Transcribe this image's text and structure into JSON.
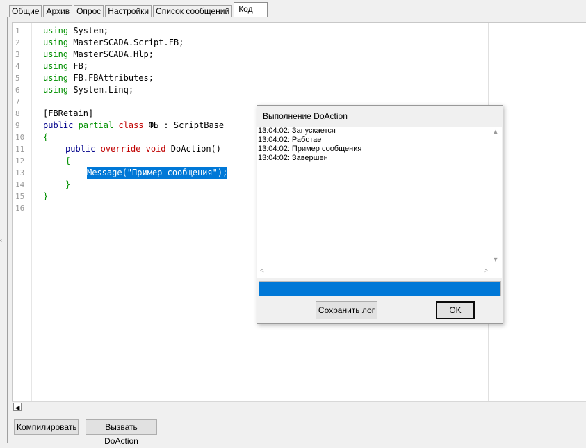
{
  "tabs": [
    {
      "label": "Общие"
    },
    {
      "label": "Архив"
    },
    {
      "label": "Опрос"
    },
    {
      "label": "Настройки"
    },
    {
      "label": "Список сообщений"
    },
    {
      "label": "Код"
    }
  ],
  "active_tab": "Код",
  "code_lines": [
    {
      "n": "1"
    },
    {
      "n": "2"
    },
    {
      "n": "3"
    },
    {
      "n": "4"
    },
    {
      "n": "5"
    },
    {
      "n": "6"
    },
    {
      "n": "7"
    },
    {
      "n": "8"
    },
    {
      "n": "9"
    },
    {
      "n": "10"
    },
    {
      "n": "11"
    },
    {
      "n": "12"
    },
    {
      "n": "13"
    },
    {
      "n": "14"
    },
    {
      "n": "15"
    },
    {
      "n": "16"
    }
  ],
  "code": {
    "l1": [
      "using",
      " System;"
    ],
    "l2": [
      "using",
      " MasterSCADA.Script.FB;"
    ],
    "l3": [
      "using",
      " MasterSCADA.Hlp;"
    ],
    "l4": [
      "using",
      " FB;"
    ],
    "l5": [
      "using",
      " FB.FBAttributes;"
    ],
    "l6": [
      "using",
      " System.Linq;"
    ],
    "l8": "[FBRetain]",
    "l9": [
      "public",
      "partial",
      "class",
      " ФБ : ScriptBase"
    ],
    "l10": "{",
    "l11": [
      "public",
      "override",
      "void",
      " DoAction()"
    ],
    "l12": "{",
    "l13": "Message(\"Пример сообщения\");",
    "l14": "}",
    "l15": "}"
  },
  "buttons": {
    "compile": "Компилировать",
    "call_doaction": "Вызвать DoAction"
  },
  "dialog": {
    "title": "Выполнение DoAction",
    "log": [
      "13:04:02: Запускается",
      "13:04:02: Работает",
      "13:04:02: Пример сообщения",
      "13:04:02: Завершен"
    ],
    "progress": 1.0,
    "save_log": "Сохранить лог",
    "ok": "OK"
  },
  "colors": {
    "selection": "#0078d7",
    "keyword_green": "#009000",
    "keyword_navy": "#00008b",
    "keyword_red": "#c00000"
  }
}
